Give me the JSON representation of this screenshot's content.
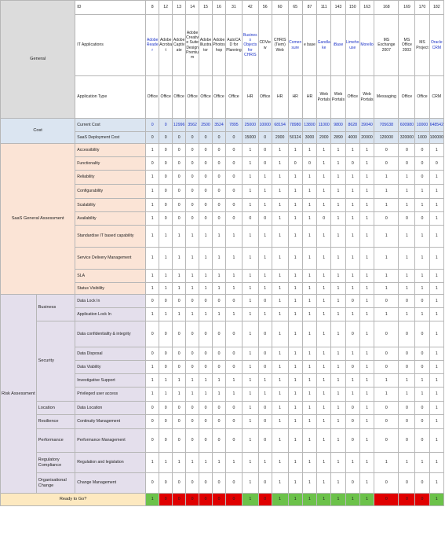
{
  "table": {
    "headers": {
      "id": "ID",
      "apps": "IT Applications",
      "type": "Application Type",
      "current_cost": "Current Cost",
      "deploy_cost": "SaaS Deployment Cost",
      "ready": "Ready to Go?"
    },
    "sections": {
      "general": "General",
      "cost": "Cost",
      "saas": "SaaS General Assessment",
      "risk": "Risk Assessment",
      "business": "Business",
      "security": "Security",
      "location": "Location",
      "resilience": "Resilience",
      "performance": "Performance",
      "regulatory": "Regulatory Compliance",
      "org": "Organisational Change"
    },
    "columns": [
      {
        "id": "8",
        "app": "Adobe Reader",
        "type": "Office",
        "blue": true,
        "cur": "0",
        "dep": "0",
        "ready": "1"
      },
      {
        "id": "12",
        "app": "Adobe Acrobat",
        "type": "Office",
        "blue": false,
        "cur": "0",
        "dep": "0",
        "ready": "0"
      },
      {
        "id": "13",
        "app": "Adobe Captivate",
        "type": "Office",
        "blue": false,
        "cur": "12996",
        "dep": "0",
        "ready": "0"
      },
      {
        "id": "14",
        "app": "Adobe Creative Suite Design Premium",
        "type": "Office",
        "blue": false,
        "cur": "3562",
        "dep": "0",
        "ready": "0"
      },
      {
        "id": "15",
        "app": "Adobe Illustrator",
        "type": "Office",
        "blue": false,
        "cur": "2500",
        "dep": "0",
        "ready": "0"
      },
      {
        "id": "16",
        "app": "Adobe Photoshop",
        "type": "Office",
        "blue": false,
        "cur": "3524",
        "dep": "0",
        "ready": "0"
      },
      {
        "id": "31",
        "app": "AutoCAD for Planning",
        "type": "Office",
        "blue": false,
        "cur": "7895",
        "dep": "0",
        "ready": "0"
      },
      {
        "id": "42",
        "app": "Business Objects for CHRIS",
        "type": "HR",
        "blue": true,
        "cur": "25000",
        "dep": "15000",
        "ready": "1"
      },
      {
        "id": "56",
        "app": "CDView",
        "type": "Office",
        "blue": false,
        "cur": "10000",
        "dep": "0",
        "ready": "0"
      },
      {
        "id": "60",
        "app": "CHRIS (Tiem) Web",
        "type": "HR",
        "blue": false,
        "cur": "68194",
        "dep": "2000",
        "ready": "1"
      },
      {
        "id": "65",
        "app": "Comensure",
        "type": "HR",
        "blue": true,
        "cur": "78980",
        "dep": "50124",
        "ready": "1"
      },
      {
        "id": "87",
        "app": "e base",
        "type": "HR",
        "blue": false,
        "cur": "13800",
        "dep": "3000",
        "ready": "1"
      },
      {
        "id": "111",
        "app": "Gandlake",
        "type": "Web Portals",
        "blue": true,
        "cur": "11000",
        "dep": "2000",
        "ready": "1"
      },
      {
        "id": "143",
        "app": "iBase",
        "type": "Web Portals",
        "blue": true,
        "cur": "9800",
        "dep": "2890",
        "ready": "1"
      },
      {
        "id": "150",
        "app": "Limehouse",
        "type": "Office",
        "blue": true,
        "cur": "8628",
        "dep": "4000",
        "ready": "1"
      },
      {
        "id": "163",
        "app": "Morello",
        "type": "Web Portals",
        "blue": true,
        "cur": "39040",
        "dep": "20000",
        "ready": "1"
      },
      {
        "id": "168",
        "app": "MS Exchange 2007",
        "type": "Messaging",
        "blue": false,
        "cur": "705638",
        "dep": "120000",
        "ready": "0"
      },
      {
        "id": "169",
        "app": "MS Office 2003",
        "type": "Office",
        "blue": false,
        "cur": "600980",
        "dep": "320000",
        "ready": "0"
      },
      {
        "id": "170",
        "app": "MS Project",
        "type": "Office",
        "blue": false,
        "cur": "10000",
        "dep": "1000",
        "ready": "0"
      },
      {
        "id": "182",
        "app": "Oracle CRM",
        "type": "CRM",
        "blue": true,
        "cur": "648542",
        "dep": "100000",
        "ready": "1"
      }
    ],
    "saas_rows": [
      {
        "label": "Accessibility",
        "vals": [
          "1",
          "0",
          "0",
          "0",
          "0",
          "0",
          "0",
          "1",
          "0",
          "1",
          "1",
          "1",
          "1",
          "1",
          "1",
          "1",
          "0",
          "0",
          "0",
          "1"
        ]
      },
      {
        "label": "Functionality",
        "vals": [
          "0",
          "0",
          "0",
          "0",
          "0",
          "0",
          "0",
          "1",
          "0",
          "1",
          "0",
          "0",
          "1",
          "1",
          "0",
          "1",
          "0",
          "0",
          "0",
          "0"
        ]
      },
      {
        "label": "Reliability",
        "vals": [
          "1",
          "0",
          "0",
          "0",
          "0",
          "0",
          "0",
          "1",
          "1",
          "1",
          "1",
          "1",
          "1",
          "1",
          "1",
          "1",
          "1",
          "1",
          "0",
          "1"
        ]
      },
      {
        "label": "Configurability",
        "vals": [
          "1",
          "0",
          "0",
          "0",
          "0",
          "0",
          "0",
          "1",
          "1",
          "1",
          "1",
          "1",
          "1",
          "1",
          "1",
          "1",
          "1",
          "1",
          "1",
          "1"
        ]
      },
      {
        "label": "Scalability",
        "vals": [
          "1",
          "0",
          "0",
          "0",
          "0",
          "0",
          "0",
          "1",
          "1",
          "1",
          "1",
          "1",
          "1",
          "1",
          "1",
          "1",
          "1",
          "1",
          "1",
          "1"
        ]
      },
      {
        "label": "Availability",
        "vals": [
          "1",
          "0",
          "0",
          "0",
          "0",
          "0",
          "0",
          "0",
          "0",
          "1",
          "1",
          "1",
          "0",
          "1",
          "1",
          "1",
          "0",
          "0",
          "0",
          "1"
        ]
      },
      {
        "label": "Standardise IT based capability",
        "vals": [
          "1",
          "1",
          "1",
          "1",
          "1",
          "1",
          "1",
          "1",
          "1",
          "1",
          "1",
          "1",
          "1",
          "1",
          "1",
          "1",
          "1",
          "1",
          "1",
          "1"
        ]
      },
      {
        "label": "Service Delivery Management",
        "vals": [
          "1",
          "1",
          "1",
          "1",
          "1",
          "1",
          "1",
          "1",
          "1",
          "1",
          "1",
          "1",
          "1",
          "1",
          "1",
          "1",
          "1",
          "1",
          "1",
          "1"
        ]
      },
      {
        "label": "SLA",
        "vals": [
          "1",
          "1",
          "1",
          "1",
          "1",
          "1",
          "1",
          "1",
          "1",
          "1",
          "1",
          "1",
          "1",
          "1",
          "1",
          "1",
          "1",
          "1",
          "1",
          "1"
        ]
      },
      {
        "label": "Status Visibility",
        "vals": [
          "1",
          "1",
          "1",
          "1",
          "1",
          "1",
          "1",
          "1",
          "1",
          "1",
          "1",
          "1",
          "1",
          "1",
          "1",
          "1",
          "1",
          "1",
          "1",
          "1"
        ]
      }
    ],
    "risk_rows": [
      {
        "group": "business",
        "label": "Data Lock In",
        "vals": [
          "0",
          "0",
          "0",
          "0",
          "0",
          "0",
          "0",
          "1",
          "0",
          "1",
          "1",
          "1",
          "1",
          "1",
          "0",
          "1",
          "0",
          "0",
          "0",
          "1"
        ]
      },
      {
        "group": "business",
        "label": "Application Lock In",
        "vals": [
          "1",
          "1",
          "1",
          "1",
          "1",
          "1",
          "1",
          "1",
          "1",
          "1",
          "1",
          "1",
          "1",
          "1",
          "1",
          "1",
          "1",
          "1",
          "1",
          "1"
        ]
      },
      {
        "group": "security",
        "label": "Data confidentiality & integrity",
        "vals": [
          "0",
          "0",
          "0",
          "0",
          "0",
          "0",
          "0",
          "1",
          "0",
          "1",
          "1",
          "1",
          "1",
          "1",
          "0",
          "1",
          "0",
          "0",
          "0",
          "1"
        ]
      },
      {
        "group": "security",
        "label": "Data Disposal",
        "vals": [
          "0",
          "0",
          "0",
          "0",
          "0",
          "0",
          "0",
          "1",
          "0",
          "1",
          "1",
          "1",
          "1",
          "1",
          "1",
          "1",
          "0",
          "0",
          "0",
          "1"
        ]
      },
      {
        "group": "security",
        "label": "Data Viability",
        "vals": [
          "1",
          "0",
          "0",
          "0",
          "0",
          "0",
          "0",
          "1",
          "0",
          "1",
          "1",
          "1",
          "1",
          "1",
          "0",
          "1",
          "0",
          "0",
          "0",
          "1"
        ]
      },
      {
        "group": "security",
        "label": "Investigative Support",
        "vals": [
          "1",
          "1",
          "1",
          "1",
          "1",
          "1",
          "1",
          "1",
          "1",
          "1",
          "1",
          "1",
          "1",
          "1",
          "1",
          "1",
          "1",
          "1",
          "1",
          "1"
        ]
      },
      {
        "group": "security",
        "label": "Privileged user access",
        "vals": [
          "1",
          "1",
          "1",
          "1",
          "1",
          "1",
          "1",
          "1",
          "1",
          "1",
          "1",
          "1",
          "1",
          "1",
          "1",
          "1",
          "1",
          "1",
          "1",
          "1"
        ]
      },
      {
        "group": "location",
        "label": "Data Location",
        "vals": [
          "0",
          "0",
          "0",
          "0",
          "0",
          "0",
          "0",
          "1",
          "0",
          "1",
          "1",
          "1",
          "1",
          "1",
          "0",
          "1",
          "0",
          "0",
          "0",
          "1"
        ]
      },
      {
        "group": "resilience",
        "label": "Continuity Management",
        "vals": [
          "0",
          "0",
          "0",
          "0",
          "0",
          "0",
          "0",
          "1",
          "0",
          "1",
          "1",
          "1",
          "1",
          "1",
          "0",
          "1",
          "0",
          "0",
          "0",
          "1"
        ]
      },
      {
        "group": "performance",
        "label": "Performance Management",
        "vals": [
          "0",
          "0",
          "0",
          "0",
          "0",
          "0",
          "0",
          "1",
          "0",
          "1",
          "1",
          "1",
          "1",
          "1",
          "0",
          "1",
          "0",
          "0",
          "0",
          "1"
        ]
      },
      {
        "group": "regulatory",
        "label": "Regulation and legislation",
        "vals": [
          "1",
          "1",
          "1",
          "1",
          "1",
          "1",
          "1",
          "1",
          "1",
          "1",
          "1",
          "1",
          "1",
          "1",
          "1",
          "1",
          "1",
          "1",
          "1",
          "1"
        ]
      },
      {
        "group": "org",
        "label": "Change Management",
        "vals": [
          "0",
          "0",
          "0",
          "0",
          "0",
          "0",
          "0",
          "1",
          "0",
          "1",
          "1",
          "1",
          "1",
          "1",
          "0",
          "1",
          "0",
          "0",
          "0",
          "1"
        ]
      }
    ]
  }
}
